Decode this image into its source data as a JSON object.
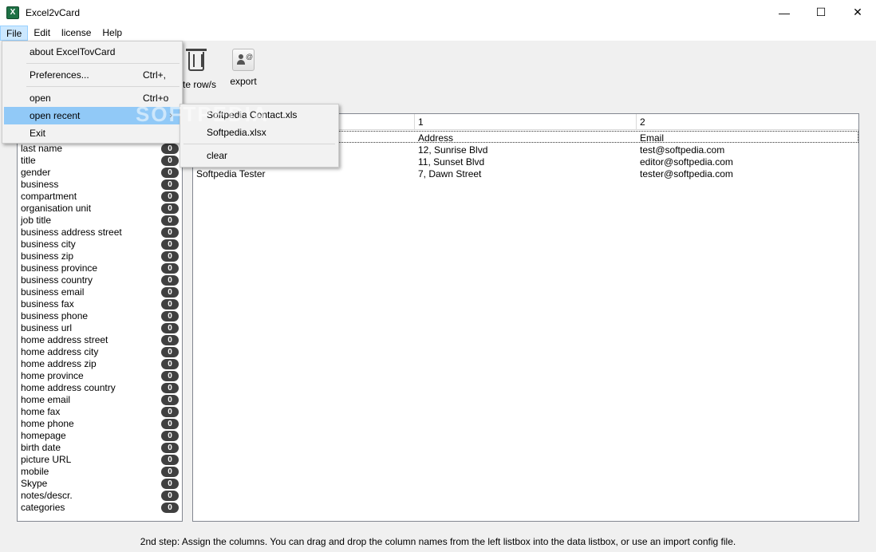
{
  "window": {
    "title": "Excel2vCard",
    "app_icon_glyph": "X",
    "minimize_glyph": "—",
    "maximize_glyph": "☐",
    "close_glyph": "✕"
  },
  "menubar": [
    "File",
    "Edit",
    "license",
    "Help"
  ],
  "toolbar": {
    "delete_label": "te row/s",
    "export_label": "export"
  },
  "file_menu": {
    "items": [
      {
        "label": "about ExcelTovCard",
        "shortcut": ""
      },
      {
        "label": "Preferences...",
        "shortcut": "Ctrl+,"
      },
      {
        "label": "open",
        "shortcut": "Ctrl+o"
      },
      {
        "label": "open recent",
        "shortcut": "",
        "arrow": "›"
      },
      {
        "label": "Exit",
        "shortcut": ""
      }
    ]
  },
  "recent_menu": {
    "files": [
      "Softpedia Contact.xls",
      "Softpedia.xlsx"
    ],
    "clear_label": "clear"
  },
  "watermark": "SOFTPEDIA",
  "fields": [
    "last name",
    "title",
    "gender",
    "business",
    "compartment",
    "organisation unit",
    "job title",
    "business address street",
    "business city",
    "business zip",
    "business province",
    "business country",
    "business email",
    "business fax",
    "business phone",
    "business url",
    "home address street",
    "home address city",
    "home address zip",
    "home province",
    "home address country",
    "home email",
    "home fax",
    "home phone",
    "homepage",
    "birth date",
    "picture URL",
    "mobile",
    "Skype",
    "notes/descr.",
    "categories"
  ],
  "field_count": "0",
  "table": {
    "headers": [
      "",
      "1",
      "2"
    ],
    "rows": [
      [
        "",
        "Address",
        "Email"
      ],
      [
        "",
        "12, Sunrise Blvd",
        "test@softpedia.com"
      ],
      [
        "",
        "11, Sunset Blvd",
        "editor@softpedia.com"
      ],
      [
        "Softpedia Tester",
        "7, Dawn Street",
        "tester@softpedia.com"
      ]
    ]
  },
  "status": "2nd step: Assign the columns. You can drag and drop the column names from the left listbox into the data listbox, or use an import config file."
}
